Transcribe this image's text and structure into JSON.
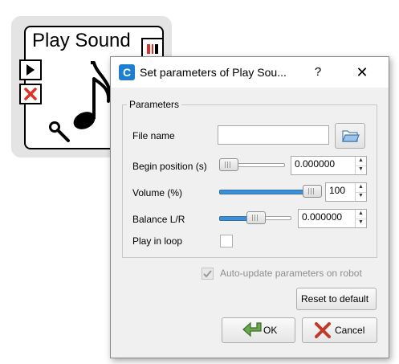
{
  "box": {
    "title": "Play Sound",
    "icons": {
      "play_port": "play-icon",
      "stop_port": "stop-icon",
      "output_port": "output-icon",
      "note": "music-note-icon",
      "wrench": "wrench-icon"
    }
  },
  "dialog": {
    "title": "Set parameters of Play Sou...",
    "app_icon_letter": "C",
    "help_label": "?",
    "close_label": "✕",
    "group_title": "Parameters",
    "fields": {
      "file_name": {
        "label": "File name",
        "value": ""
      },
      "begin_position": {
        "label": "Begin position (s)",
        "value": "0.000000",
        "slider_fraction": 0.0
      },
      "volume": {
        "label": "Volume (%)",
        "value": "100",
        "slider_fraction": 1.0
      },
      "balance": {
        "label": "Balance L/R",
        "value": "0.000000",
        "slider_fraction": 0.5
      },
      "loop": {
        "label": "Play in loop",
        "checked": false
      }
    },
    "auto_update": {
      "label": "Auto-update parameters on robot",
      "checked": true,
      "enabled": false
    },
    "buttons": {
      "reset": "Reset to default",
      "ok": "OK",
      "cancel": "Cancel"
    },
    "colors": {
      "accent": "#3a8fd8",
      "ok_icon": "#4c8a3c",
      "cancel_icon": "#c0392b"
    }
  }
}
